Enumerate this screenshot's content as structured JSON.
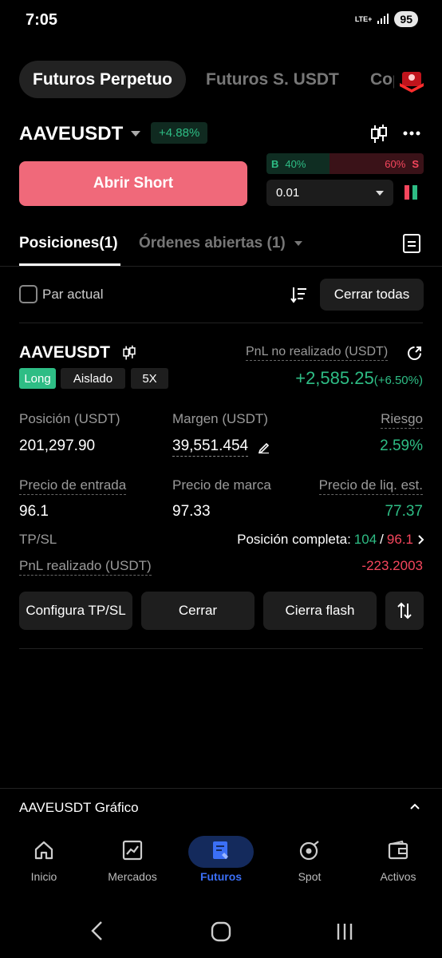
{
  "status": {
    "time": "7:05",
    "network": "LTE+",
    "battery": "95"
  },
  "top_tabs": [
    "Futuros Perpetuo",
    "Futuros S. USDT",
    "Copy"
  ],
  "pair": {
    "symbol": "AAVEUSDT",
    "change": "+4.88%"
  },
  "trade": {
    "short_label": "Abrir Short",
    "ratio": {
      "buy_letter": "B",
      "buy_pct": "40%",
      "sell_pct": "60%",
      "sell_letter": "S",
      "buy_fraction": 0.4
    },
    "quantity": "0.01"
  },
  "position_tabs": {
    "positions": "Posiciones(1)",
    "orders": "Órdenes abiertas (1)"
  },
  "filter": {
    "current_pair": "Par actual",
    "close_all": "Cerrar todas"
  },
  "position": {
    "symbol": "AAVEUSDT",
    "unrealized_label": "PnL no realizado (USDT)",
    "unrealized_value": "+2,585.25",
    "unrealized_pct": "(+6.50%)",
    "tags": [
      "Long",
      "Aislado",
      "5X"
    ],
    "size_label": "Posición (USDT)",
    "size_value": "201,297.90",
    "margin_label": "Margen (USDT)",
    "margin_value": "39,551.454",
    "risk_label": "Riesgo",
    "risk_value": "2.59%",
    "entry_label": "Precio de entrada",
    "entry_value": "96.1",
    "mark_label": "Precio de marca",
    "mark_value": "97.33",
    "liq_label": "Precio de liq. est.",
    "liq_value": "77.37",
    "tpsl_label": "TP/SL",
    "full_pos_label": "Posición completa:",
    "tp_value": "104",
    "slash": "/",
    "sl_value": "96.1",
    "realized_label": "PnL realizado (USDT)",
    "realized_value": "-223.2003",
    "actions": [
      "Configura TP/SL",
      "Cerrar",
      "Cierra flash"
    ]
  },
  "chart_bar": {
    "label": "AAVEUSDT Gráfico"
  },
  "nav": [
    "Inicio",
    "Mercados",
    "Futuros",
    "Spot",
    "Activos"
  ],
  "colors": {
    "green": "#2ebd85",
    "red": "#f6465d",
    "short": "#f0697a",
    "accent": "#3b6ff6"
  }
}
